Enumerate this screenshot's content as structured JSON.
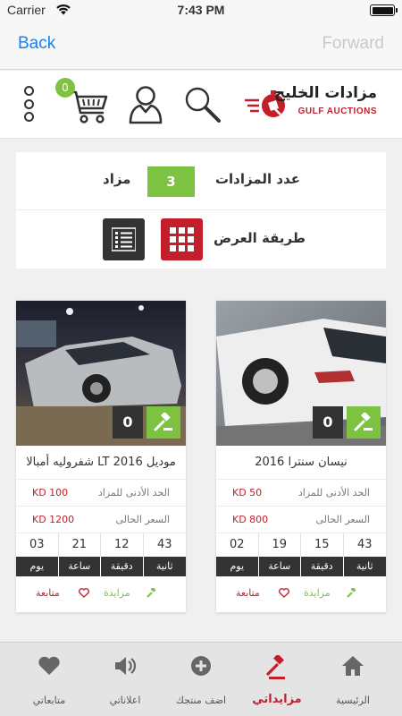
{
  "status": {
    "carrier": "Carrier",
    "time": "7:43 PM"
  },
  "nav": {
    "back": "Back",
    "forward": "Forward"
  },
  "header": {
    "cart_count": "0",
    "logo_arabic": "مزادات الخليج",
    "logo_latin": "GULF AUCTIONS",
    "colors": {
      "brand_red": "#c41e2a",
      "accent_green": "#7ec242",
      "dark": "#333333"
    }
  },
  "summary": {
    "count_label": "عدد المزادات",
    "count": "3",
    "count_unit": "مزاد",
    "view_label": "طريقة العرض"
  },
  "cards": [
    {
      "title": "موديل LT 2016 شفروليه أمبالا",
      "bids": "0",
      "min_label": "الحد الأدنى للمزاد",
      "min_value": "KD 100",
      "current_label": "السعر الحالى",
      "current_value": "KD 1200",
      "timer": [
        "03",
        "21",
        "12",
        "43"
      ],
      "timer_labels": [
        "يوم",
        "ساعة",
        "دقيقة",
        "ثانية"
      ],
      "bid_label": "مزايدة",
      "follow_label": "متابعة"
    },
    {
      "title": "نيسان سنترا 2016",
      "bids": "0",
      "min_label": "الحد الأدنى للمزاد",
      "min_value": "KD 50",
      "current_label": "السعر الحالى",
      "current_value": "KD 800",
      "timer": [
        "02",
        "19",
        "15",
        "43"
      ],
      "timer_labels": [
        "يوم",
        "ساعة",
        "دقيقة",
        "ثانية"
      ],
      "bid_label": "مزايدة",
      "follow_label": "متابعة"
    }
  ],
  "tabs": [
    {
      "label": "متابعاتي",
      "icon": "heart-icon"
    },
    {
      "label": "اعلاناتي",
      "icon": "megaphone-icon"
    },
    {
      "label": "اضف منتجك",
      "icon": "plus-circle-icon"
    },
    {
      "label": "مزايداتي",
      "icon": "gavel-icon",
      "active": true
    },
    {
      "label": "الرئيسية",
      "icon": "home-icon"
    }
  ]
}
